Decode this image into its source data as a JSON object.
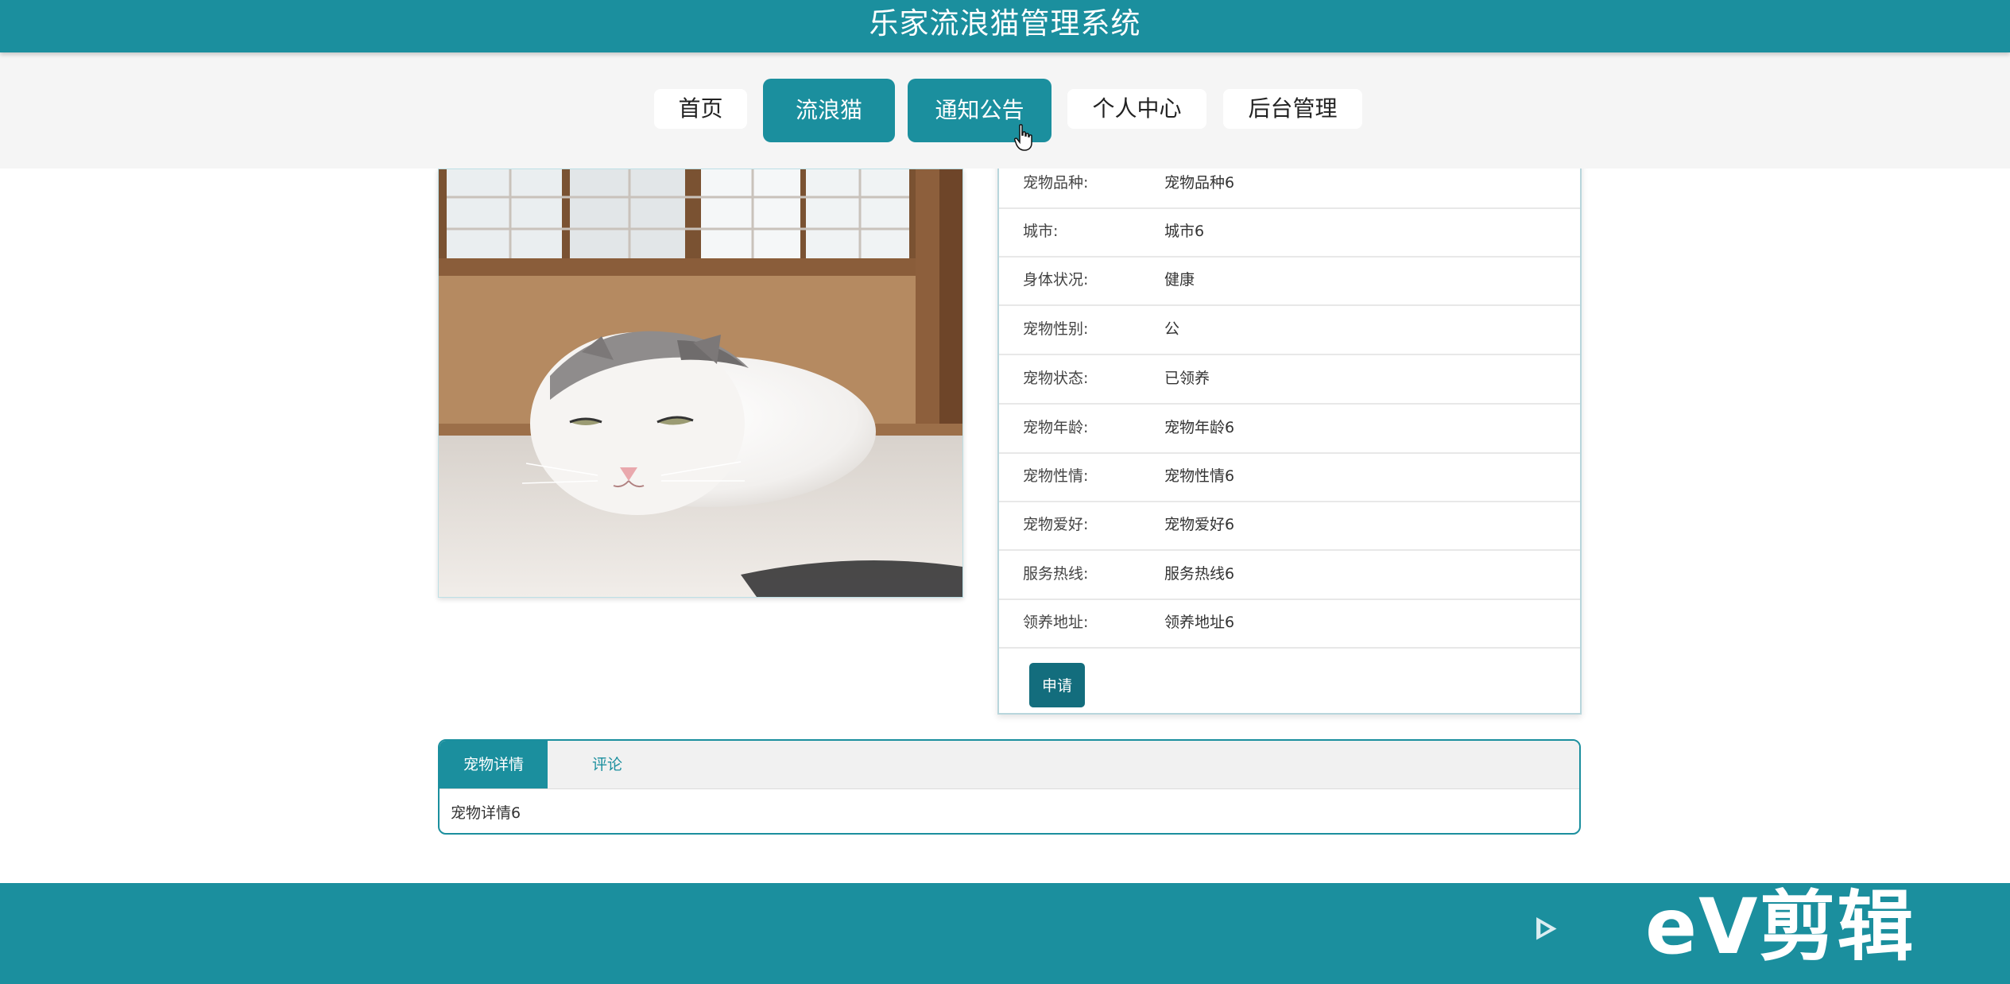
{
  "header": {
    "title": "乐家流浪猫管理系统"
  },
  "nav": {
    "items": [
      {
        "label": "首页"
      },
      {
        "label": "流浪猫"
      },
      {
        "label": "通知公告"
      },
      {
        "label": "个人中心"
      },
      {
        "label": "后台管理"
      }
    ]
  },
  "details": {
    "rows": [
      {
        "label": "宠物品种:",
        "value": "宠物品种6"
      },
      {
        "label": "城市:",
        "value": "城市6"
      },
      {
        "label": "身体状况:",
        "value": "健康"
      },
      {
        "label": "宠物性别:",
        "value": "公"
      },
      {
        "label": "宠物状态:",
        "value": "已领养"
      },
      {
        "label": "宠物年龄:",
        "value": "宠物年龄6"
      },
      {
        "label": "宠物性情:",
        "value": "宠物性情6"
      },
      {
        "label": "宠物爱好:",
        "value": "宠物爱好6"
      },
      {
        "label": "服务热线:",
        "value": "服务热线6"
      },
      {
        "label": "领养地址:",
        "value": "领养地址6"
      }
    ],
    "apply_label": "申请"
  },
  "tabs": {
    "items": [
      {
        "label": "宠物详情"
      },
      {
        "label": "评论"
      }
    ],
    "content": "宠物详情6"
  },
  "watermark": {
    "text": "eV剪辑"
  },
  "colors": {
    "primary": "#1b8f9e",
    "button_dark": "#136d7d",
    "nav_bg": "#f5f5f5"
  }
}
